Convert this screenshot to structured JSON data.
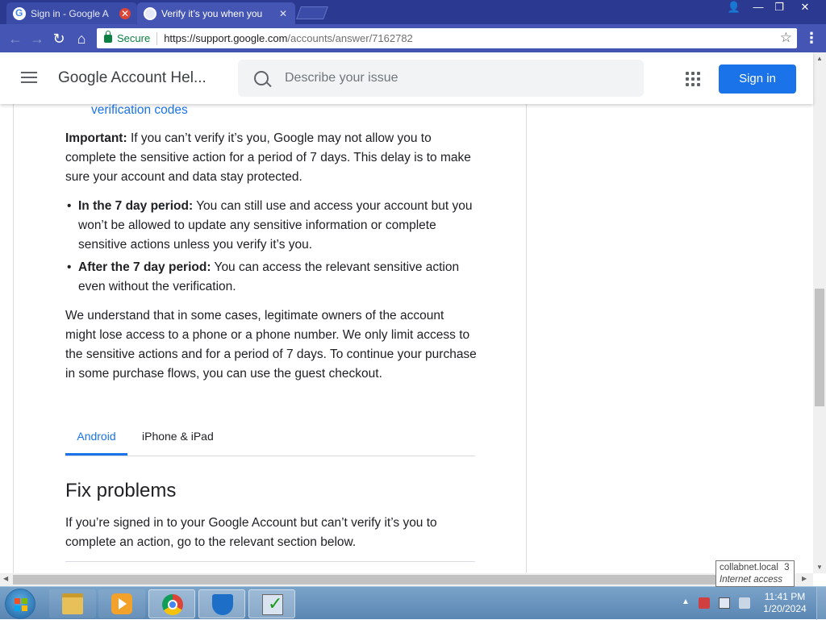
{
  "browser": {
    "tabs": [
      {
        "title": "Sign in - Google A",
        "active": false
      },
      {
        "title": "Verify it’s you when you",
        "active": true
      }
    ],
    "address": {
      "secure_label": "Secure",
      "url_host": "https://support.google.com",
      "url_path": "/accounts/answer/7162782"
    },
    "window_controls": [
      "user",
      "minimize",
      "restore",
      "close"
    ]
  },
  "header": {
    "site_title": "Google Account Hel...",
    "search_placeholder": "Describe your issue",
    "sign_in": "Sign in"
  },
  "article": {
    "link_tail": "verification codes",
    "important_label": "Important:",
    "important_text": " If you can’t verify it’s you, Google may not allow you to complete the sensitive action for a period of 7 days. This delay is to make sure your account and data stay protected.",
    "bullets": [
      {
        "label": "In the 7 day period:",
        "text": " You can still use and access your account but you won’t be allowed to update any sensitive information or complete sensitive actions unless you verify it’s you."
      },
      {
        "label": "After the 7 day period:",
        "text": " You can access the relevant sensitive action even without the verification."
      }
    ],
    "understand_text": "We understand that in some cases, legitimate owners of the account might lose access to a phone or a phone number. We only limit access to the sensitive actions and for a period of 7 days. To continue your purchase in some purchase flows, you can use the guest checkout.",
    "content_tabs": [
      "Android",
      "iPhone & iPad"
    ],
    "active_tab": "Android",
    "section_heading": "Fix problems",
    "section_text": "If you’re signed in to your Google Account but can’t verify it’s you to complete an action, go to the relevant section below."
  },
  "tooltip": {
    "host": "collabnet.local",
    "count": "3",
    "status": "Internet access"
  },
  "taskbar": {
    "apps": [
      "folder-icon",
      "media-player-icon",
      "chrome-icon",
      "shield-icon",
      "checklist-icon"
    ],
    "clock_time": "11:41 PM",
    "clock_date": "1/20/2024"
  },
  "colors": {
    "chrome_frame": "#2b3990",
    "toolbar": "#4455b3",
    "accent": "#1a73e8",
    "secure_green": "#0b8043"
  }
}
